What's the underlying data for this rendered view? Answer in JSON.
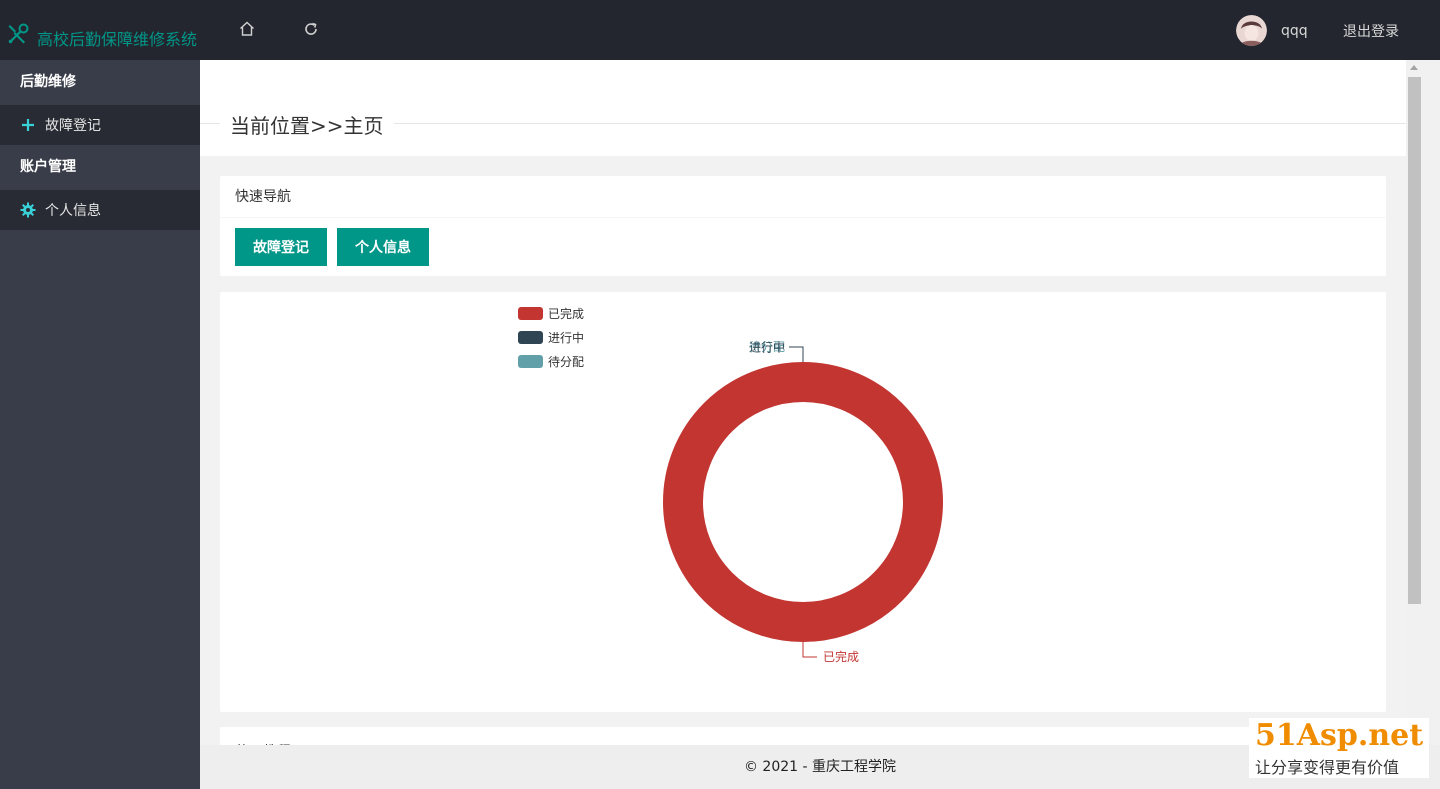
{
  "header": {
    "app_title": "高校后勤保障维修系统",
    "username": "qqq",
    "logout_label": "退出登录",
    "accent_color": "#009688"
  },
  "sidebar": {
    "groups": [
      {
        "title": "后勤维修",
        "items": [
          {
            "label": "故障登记",
            "icon": "plus-icon"
          }
        ]
      },
      {
        "title": "账户管理",
        "items": [
          {
            "label": "个人信息",
            "icon": "gear-icon"
          }
        ]
      }
    ]
  },
  "main": {
    "breadcrumb": "当前位置>>主页",
    "quick_nav": {
      "title": "快速导航",
      "buttons": [
        "故障登记",
        "个人信息"
      ]
    },
    "next_card_title": "使用教程"
  },
  "chart_data": {
    "type": "pie",
    "legend": [
      "已完成",
      "进行中",
      "待分配"
    ],
    "colors": [
      "#c23531",
      "#2f4554",
      "#61a0a8"
    ],
    "values": [
      1,
      0,
      0
    ],
    "slice_labels": [
      "已完成",
      "进行中",
      "待分配"
    ],
    "legend_position": "top-left",
    "donut": true
  },
  "footer": {
    "text": "© 2021 - 重庆工程学院"
  },
  "watermark": {
    "brand": "51Asp.net",
    "slogan": "让分享变得更有价值"
  }
}
